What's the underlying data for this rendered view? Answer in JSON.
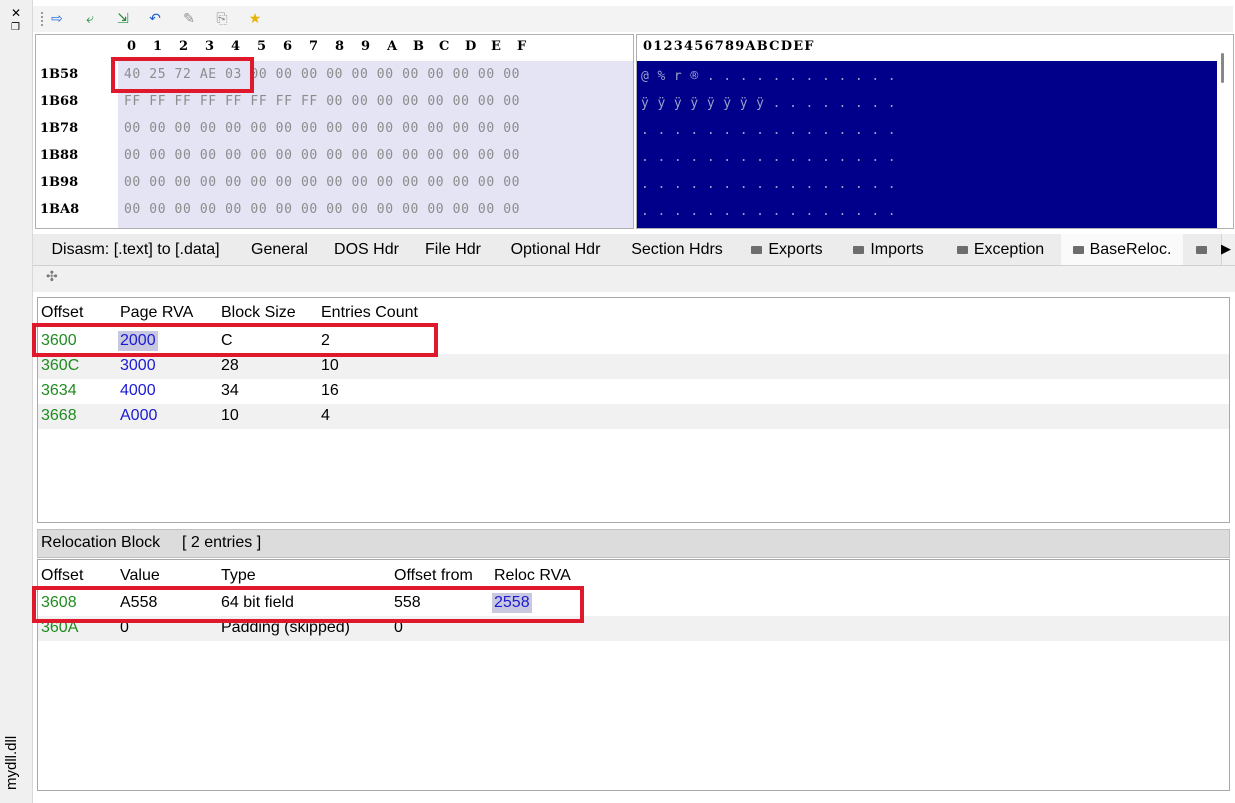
{
  "dock": {
    "close": "✕",
    "restore": "❐",
    "title": "mydll.dll"
  },
  "toolbar": {
    "icons": [
      "arrow-right-icon",
      "go-to-icon",
      "export-icon",
      "undo-icon",
      "pin-icon",
      "copy-icon",
      "star-icon"
    ]
  },
  "hex": {
    "columns": [
      "0",
      "1",
      "2",
      "3",
      "4",
      "5",
      "6",
      "7",
      "8",
      "9",
      "A",
      "B",
      "C",
      "D",
      "E",
      "F"
    ],
    "rows": [
      {
        "addr": "1B58",
        "bytes": "40 25 72 AE 03 00 00 00 00 00 00 00 00 00 00 00",
        "ascii": "@ % r ® . . . . . . . . . . . ."
      },
      {
        "addr": "1B68",
        "bytes": "FF FF FF FF FF FF FF FF 00 00 00 00 00 00 00 00",
        "ascii": "ÿ ÿ ÿ ÿ ÿ ÿ ÿ ÿ . . . . . . . ."
      },
      {
        "addr": "1B78",
        "bytes": "00 00 00 00 00 00 00 00 00 00 00 00 00 00 00 00",
        "ascii": ". . . . . . . . . . . . . . . ."
      },
      {
        "addr": "1B88",
        "bytes": "00 00 00 00 00 00 00 00 00 00 00 00 00 00 00 00",
        "ascii": ". . . . . . . . . . . . . . . ."
      },
      {
        "addr": "1B98",
        "bytes": "00 00 00 00 00 00 00 00 00 00 00 00 00 00 00 00",
        "ascii": ". . . . . . . . . . . . . . . ."
      },
      {
        "addr": "1BA8",
        "bytes": "00 00 00 00 00 00 00 00 00 00 00 00 00 00 00 00",
        "ascii": ". . . . . . . . . . . . . . . ."
      }
    ],
    "ascii_header": "0123456789ABCDEF"
  },
  "tabs": [
    {
      "label": "Disasm: [.text] to [.data]",
      "folder": false
    },
    {
      "label": "General",
      "folder": false
    },
    {
      "label": "DOS Hdr",
      "folder": false
    },
    {
      "label": "File Hdr",
      "folder": false
    },
    {
      "label": "Optional Hdr",
      "folder": false
    },
    {
      "label": "Section Hdrs",
      "folder": false
    },
    {
      "label": "Exports",
      "folder": true
    },
    {
      "label": "Imports",
      "folder": true
    },
    {
      "label": "Exception",
      "folder": true
    },
    {
      "label": "BaseReloc.",
      "folder": true,
      "active": true
    }
  ],
  "tab_scroll": "▶",
  "blocks": {
    "headers": [
      "Offset",
      "Page RVA",
      "Block Size",
      "Entries Count"
    ],
    "rows": [
      [
        "3600",
        "2000",
        "C",
        "2"
      ],
      [
        "360C",
        "3000",
        "28",
        "10"
      ],
      [
        "3634",
        "4000",
        "34",
        "16"
      ],
      [
        "3668",
        "A000",
        "10",
        "4"
      ]
    ]
  },
  "reloc": {
    "title": "Relocation Block",
    "entries": "[ 2 entries ]",
    "headers": [
      "Offset",
      "Value",
      "Type",
      "Offset from",
      "Reloc RVA"
    ],
    "rows": [
      [
        "3608",
        "A558",
        "64 bit field",
        "558",
        "2558"
      ],
      [
        "360A",
        "0",
        "Padding (skipped)",
        "0",
        ""
      ]
    ]
  },
  "colors": {
    "highlight_box": "#e0182c",
    "offset_text": "#1f8c1f",
    "rva_text": "#1a1ad4",
    "ascii_bg": "#00008b"
  }
}
